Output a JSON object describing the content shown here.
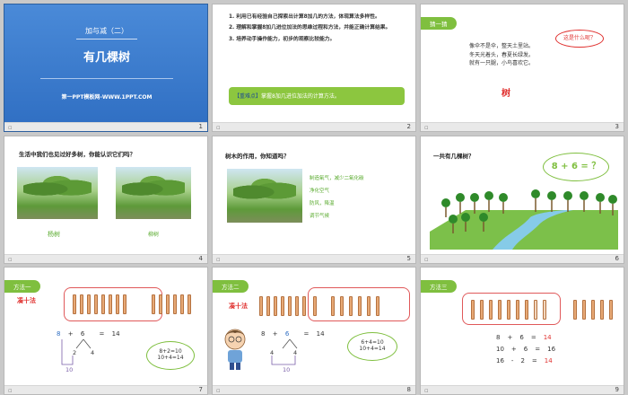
{
  "slides": [
    {
      "num": "1",
      "title_top": "加与减（二）",
      "title_main": "有几棵树",
      "credit": "第一PPT模板网-WWW.1PPT.COM"
    },
    {
      "num": "2",
      "goals": [
        "1. 利用已有经验自己探索出计算8加几的方法，体现算法多样性。",
        "2. 理解和掌握8加几进位加法的思维过程和方法，并能正确计算结果。",
        "3. 培养动手操作能力，初步的观察比较能力。"
      ],
      "key_label": "【重难点】",
      "key_text": "掌握8加几进位加法的计算方法。"
    },
    {
      "num": "3",
      "tab": "猜一猜",
      "riddle": [
        "像伞不是伞，整天土里站。",
        "冬天光着头，春夏长绿发。",
        "就有一只腿，小鸟喜欢它。"
      ],
      "bubble": "这是什么呢？",
      "answer": "树"
    },
    {
      "num": "4",
      "question": "生活中我们也见过好多树，你能认识它们吗？",
      "caption_a": "杨树",
      "caption_b": "柳树"
    },
    {
      "num": "5",
      "question": "树木的作用，你知道吗？",
      "uses": [
        "制造氧气，减少二氧化碳",
        "净化空气",
        "防风，降温",
        "调节气候"
      ]
    },
    {
      "num": "6",
      "question": "一共有几棵树？",
      "bubble": "8 + 6 = ？"
    },
    {
      "num": "7",
      "tab": "方法一",
      "method": "凑十法",
      "eq": [
        "8",
        "+",
        "6",
        "=",
        "14"
      ],
      "split": [
        "2",
        "4"
      ],
      "sum10": "10",
      "cloud": [
        "8+2=10",
        "10+4=14"
      ]
    },
    {
      "num": "8",
      "tab": "方法二",
      "method": "凑十法",
      "eq": [
        "8",
        "+",
        "6",
        "=",
        "14"
      ],
      "split": [
        "4",
        "4"
      ],
      "sum10": "10",
      "cloud": [
        "6+4=10",
        "10+4=14"
      ]
    },
    {
      "num": "9",
      "tab": "方法三",
      "rows": [
        [
          "8",
          "+",
          "6",
          "=",
          "14"
        ],
        [
          "10",
          "+",
          "6",
          "=",
          "16"
        ],
        [
          "16",
          "-",
          "2",
          "=",
          "14"
        ]
      ]
    }
  ],
  "colors": {
    "blue": "#2f6ec2",
    "green": "#7fbf3f",
    "red": "#e0312f",
    "stick": "#e7a976"
  }
}
